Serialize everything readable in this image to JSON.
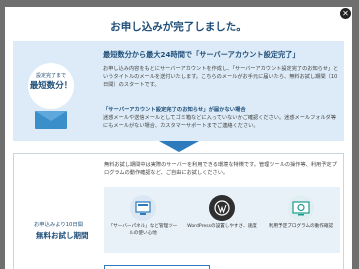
{
  "modal": {
    "title": "お申し込みが完了しました。",
    "close_glyph": "✕"
  },
  "info": {
    "badge_top": "設定完了まで",
    "badge_main": "最短数分！",
    "highlight": "最短数分から最大24時間で「サーバーアカウント設定完了」",
    "body": "お申し込み内容をもとにサーバーアカウントを作成し、「サーバーアカウント設定完了のお知らせ」というタイトルのメールを送付いたします。こちらのメールがお手元に届いたら、無料お試し期間（10日間）のスタートです。",
    "warn_title": "「サーバーアカウント設定完了のお知らせ」が届かない場合",
    "warn_text": "迷惑メールや送信メールとしてゴミ箱などに入っていないかご確認ください。迷惑メールフォルダ等にもメールがない場合、カスタマーサポートまでご連絡ください。"
  },
  "trial": {
    "side_top": "お申込みより10日間",
    "side_main": "無料お試し期間",
    "intro": "無料お試し期間中は実際のサーバーを利用できる環境な特徴です。管理ツールの操作等、利用予定プログラムの動作確認など、ご自由にお試しください。",
    "features": [
      {
        "label": "「サーバーパネル」など管理ツールの使い心地",
        "icon": "server-panel-icon"
      },
      {
        "label": "WordPressの設置しやすさ、速度",
        "icon": "wordpress-icon"
      },
      {
        "label": "利用予定プログラムの動作確認",
        "icon": "program-check-icon"
      }
    ]
  }
}
